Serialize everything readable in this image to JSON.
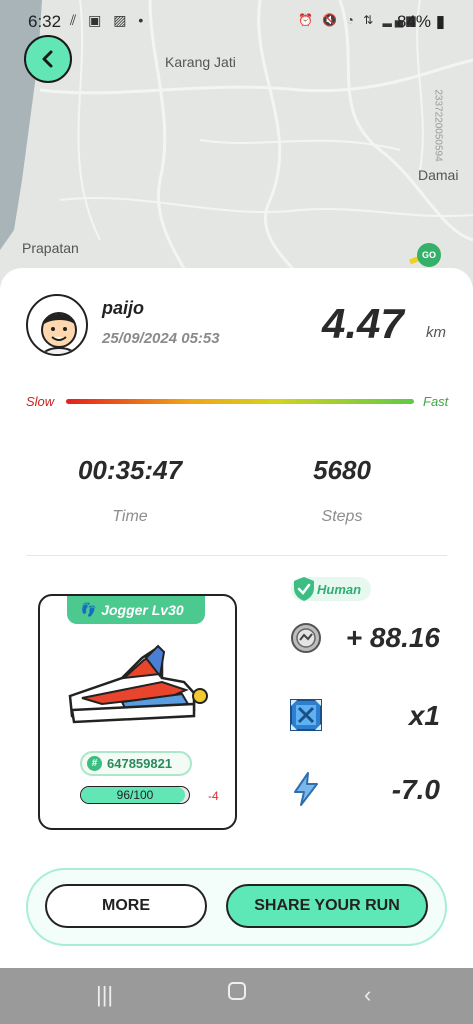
{
  "status_bar": {
    "time": "6:32",
    "battery": "84%"
  },
  "map": {
    "labels": {
      "karang_jati": "Karang Jati",
      "damai": "Damai",
      "prapatan": "Prapatan",
      "road_code": "2337220050594"
    },
    "go_pin": "GO"
  },
  "run": {
    "username": "paijo",
    "datetime": "25/09/2024 05:53",
    "distance": "4.47",
    "distance_unit": "km",
    "speed_slow": "Slow",
    "speed_fast": "Fast",
    "time_value": "00:35:47",
    "time_label": "Time",
    "steps_value": "5680",
    "steps_label": "Steps"
  },
  "shoe": {
    "tag": "Jogger Lv30",
    "id_hash": "#",
    "id": "647859821",
    "durability_text": "96/100",
    "durability_fraction": 0.96,
    "durability_delta": "-4"
  },
  "rewards": {
    "human_badge": "Human",
    "coin": "+ 88.16",
    "multiplier": "x1",
    "energy": "-7.0"
  },
  "actions": {
    "more_label": "MORE",
    "share_label": "SHARE YOUR RUN"
  },
  "colors": {
    "accent": "#5ee8b7",
    "green": "#4cc98f",
    "slow": "#cc2222",
    "fast": "#3fa83f"
  }
}
